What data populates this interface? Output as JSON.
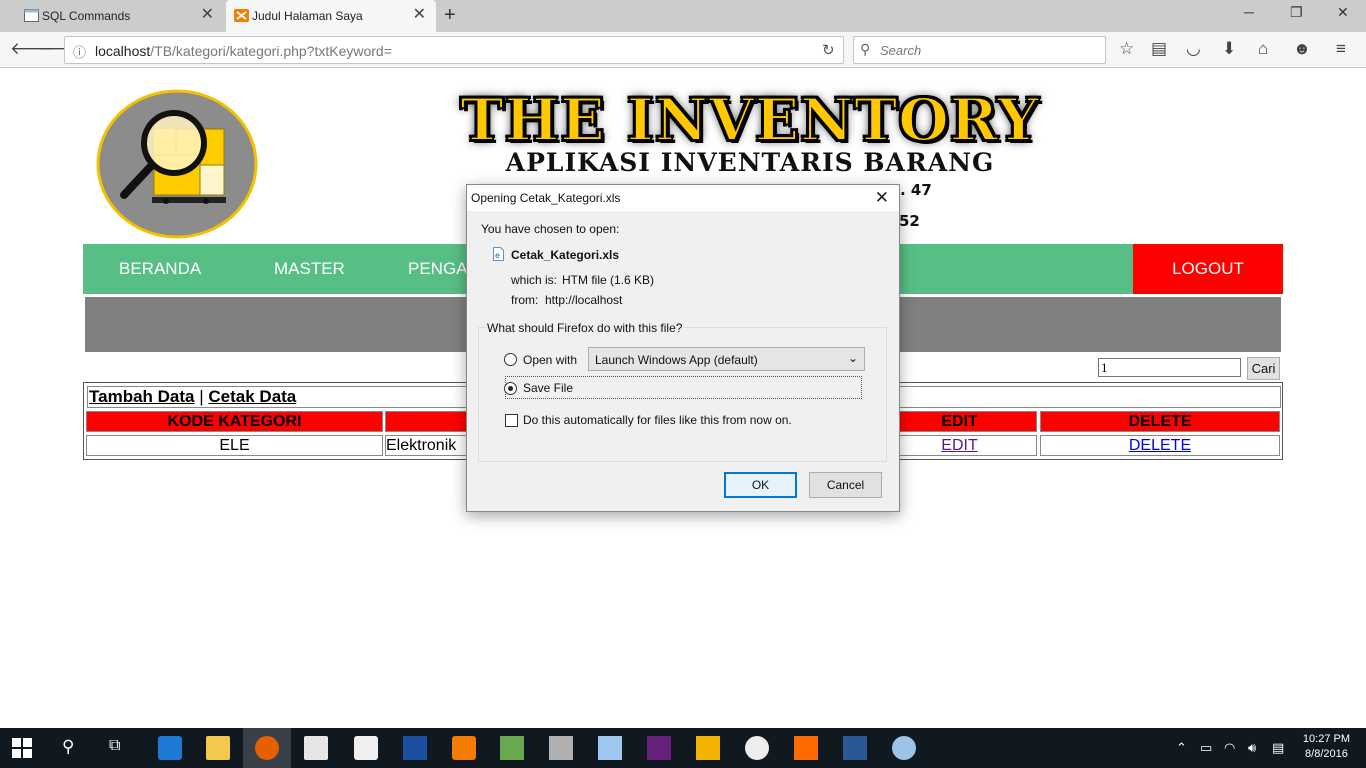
{
  "browser": {
    "tabs": [
      {
        "label": "SQL Commands"
      },
      {
        "label": "Judul Halaman Saya"
      }
    ],
    "url_host": "localhost",
    "url_path": "/TB/kategori/kategori.php?txtKeyword=",
    "search_placeholder": "Search"
  },
  "page": {
    "title": "THE INVENTORY",
    "subtitle": "APLIKASI INVENTARIS BARANG",
    "address_fragment_1": ". 47",
    "address_fragment_2": "52",
    "menu": {
      "beranda": "BERANDA",
      "master": "MASTER",
      "pengadaan": "PENGA",
      "logout": "LOGOUT"
    },
    "search": {
      "value": "1",
      "button": "Cari"
    },
    "table": {
      "add_link": "Tambah Data",
      "separator": "|",
      "print_link": "Cetak Data",
      "headers": {
        "kode": "KODE KATEGORI",
        "nama": "",
        "edit": "EDIT",
        "delete": "DELETE"
      },
      "rows": [
        {
          "kode": "ELE",
          "nama": "Elektronik",
          "edit": "EDIT",
          "delete": "DELETE"
        }
      ]
    }
  },
  "dialog": {
    "title": "Opening Cetak_Kategori.xls",
    "chosen_label": "You have chosen to open:",
    "filename": "Cetak_Kategori.xls",
    "which_is_label": "which is:",
    "which_is_value": "HTM file (1.6 KB)",
    "from_label": "from:",
    "from_value": "http://localhost",
    "question": "What should Firefox do with this file?",
    "open_with_label": "Open with",
    "open_with_value": "Launch Windows App (default)",
    "save_file_label": "Save File",
    "save_file_selected": true,
    "auto_label": "Do this automatically for files like this from now on.",
    "ok": "OK",
    "cancel": "Cancel"
  },
  "taskbar": {
    "time": "10:27 PM",
    "date": "8/8/2016"
  },
  "colors": {
    "menu_green": "#57bf85",
    "logout_red": "#ff0000",
    "header_red": "#ff0000",
    "gray_band": "#808080",
    "title_gold": "#ffc800"
  }
}
